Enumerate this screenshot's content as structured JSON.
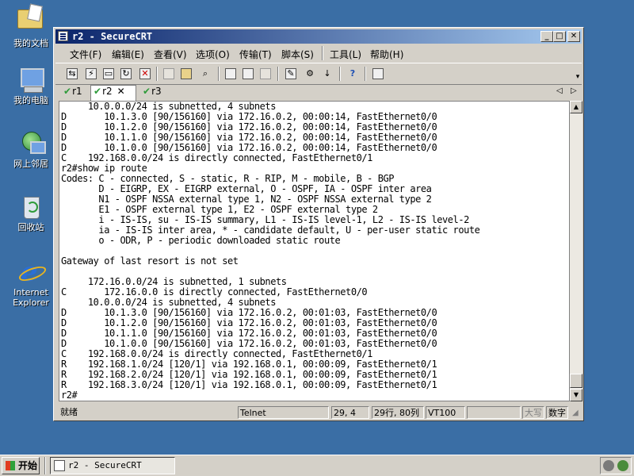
{
  "desktop": {
    "icons": [
      {
        "name": "my-documents-icon",
        "label": "我的文档"
      },
      {
        "name": "my-computer-icon",
        "label": "我的电脑"
      },
      {
        "name": "network-places-icon",
        "label": "网上邻居"
      },
      {
        "name": "recycle-bin-icon",
        "label": "回收站"
      },
      {
        "name": "internet-explorer-icon",
        "label": "Internet Explorer"
      }
    ]
  },
  "window": {
    "title": "r2 - SecureCRT",
    "controls": {
      "minimize": "_",
      "maximize": "□",
      "close": "✕"
    }
  },
  "menu": {
    "items": [
      "文件(F)",
      "编辑(E)",
      "查看(V)",
      "选项(O)",
      "传输(T)",
      "脚本(S)",
      "工具(L)",
      "帮助(H)"
    ]
  },
  "toolbar": {
    "icons": [
      "connect-icon",
      "quick-connect-icon",
      "connect-tab-icon",
      "reconnect-icon",
      "disconnect-icon",
      "copy-icon",
      "paste-icon",
      "find-icon",
      "print-icon",
      "print-selection-icon",
      "print-setup-icon",
      "session-options-icon",
      "global-options-icon",
      "keymap-icon",
      "help-icon",
      "log-icon"
    ]
  },
  "tabs": [
    {
      "label": "r1",
      "active": false
    },
    {
      "label": "r2",
      "active": true,
      "close": "✕"
    },
    {
      "label": "r3",
      "active": false
    }
  ],
  "terminal": {
    "lines": [
      "     10.0.0.0/24 is subnetted, 4 subnets",
      "D       10.1.3.0 [90/156160] via 172.16.0.2, 00:00:14, FastEthernet0/0",
      "D       10.1.2.0 [90/156160] via 172.16.0.2, 00:00:14, FastEthernet0/0",
      "D       10.1.1.0 [90/156160] via 172.16.0.2, 00:00:14, FastEthernet0/0",
      "D       10.1.0.0 [90/156160] via 172.16.0.2, 00:00:14, FastEthernet0/0",
      "C    192.168.0.0/24 is directly connected, FastEthernet0/1",
      "r2#show ip route",
      "Codes: C - connected, S - static, R - RIP, M - mobile, B - BGP",
      "       D - EIGRP, EX - EIGRP external, O - OSPF, IA - OSPF inter area",
      "       N1 - OSPF NSSA external type 1, N2 - OSPF NSSA external type 2",
      "       E1 - OSPF external type 1, E2 - OSPF external type 2",
      "       i - IS-IS, su - IS-IS summary, L1 - IS-IS level-1, L2 - IS-IS level-2",
      "       ia - IS-IS inter area, * - candidate default, U - per-user static route",
      "       o - ODR, P - periodic downloaded static route",
      "",
      "Gateway of last resort is not set",
      "",
      "     172.16.0.0/24 is subnetted, 1 subnets",
      "C       172.16.0.0 is directly connected, FastEthernet0/0",
      "     10.0.0.0/24 is subnetted, 4 subnets",
      "D       10.1.3.0 [90/156160] via 172.16.0.2, 00:01:03, FastEthernet0/0",
      "D       10.1.2.0 [90/156160] via 172.16.0.2, 00:01:03, FastEthernet0/0",
      "D       10.1.1.0 [90/156160] via 172.16.0.2, 00:01:03, FastEthernet0/0",
      "D       10.1.0.0 [90/156160] via 172.16.0.2, 00:01:03, FastEthernet0/0",
      "C    192.168.0.0/24 is directly connected, FastEthernet0/1",
      "R    192.168.1.0/24 [120/1] via 192.168.0.1, 00:00:09, FastEthernet0/1",
      "R    192.168.2.0/24 [120/1] via 192.168.0.1, 00:00:09, FastEthernet0/1",
      "R    192.168.3.0/24 [120/1] via 192.168.0.1, 00:00:09, FastEthernet0/1",
      "r2#"
    ]
  },
  "statusbar": {
    "ready": "就绪",
    "protocol": "Telnet",
    "cursor": "29,  4",
    "size": "29行, 80列",
    "emulation": "VT100",
    "blank": "",
    "caps": "大写",
    "num": "数字"
  },
  "taskbar": {
    "start_label": "开始",
    "task_title": "r2 - SecureCRT"
  }
}
